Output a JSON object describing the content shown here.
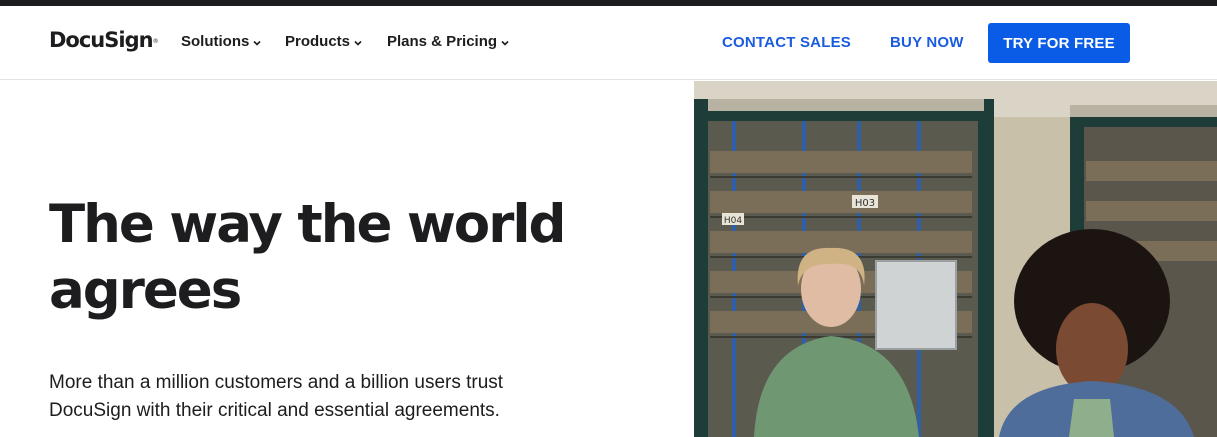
{
  "brand": {
    "name": "DocuSign",
    "mark": "®",
    "accent_color": "#0a5ce6",
    "text_color": "#1d1c1f"
  },
  "nav": {
    "menus": [
      {
        "label": "Solutions",
        "icon": "chevron-down-icon"
      },
      {
        "label": "Products",
        "icon": "chevron-down-icon"
      },
      {
        "label": "Plans & Pricing",
        "icon": "chevron-down-icon"
      }
    ],
    "contact_sales": "CONTACT SALES",
    "buy_now": "BUY NOW",
    "try_free": "TRY FOR FREE"
  },
  "hero": {
    "title_line1": "The way the world",
    "title_line2": "agrees",
    "subtitle_line1": "More than a million customers and a billion users trust",
    "subtitle_line2": "DocuSign with their critical and essential agreements.",
    "image_shelf_labels": [
      "H04",
      "H03"
    ]
  }
}
